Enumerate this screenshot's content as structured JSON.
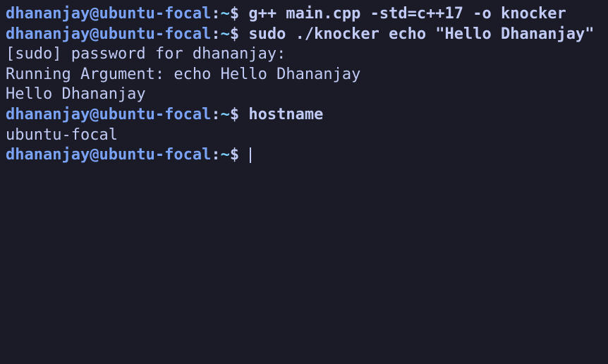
{
  "prompt": {
    "user_host": "dhananjay@ubuntu-focal",
    "colon": ":",
    "path": "~",
    "symbol": "$"
  },
  "lines": [
    {
      "type": "cmd",
      "command": "g++ main.cpp -std=c++17 -o knocker"
    },
    {
      "type": "cmd",
      "command": "sudo ./knocker echo \"Hello Dhananjay\""
    },
    {
      "type": "out",
      "text": "[sudo] password for dhananjay: "
    },
    {
      "type": "out",
      "text": "Running Argument: echo Hello Dhananjay"
    },
    {
      "type": "out",
      "text": "Hello Dhananjay"
    },
    {
      "type": "cmd",
      "command": "hostname"
    },
    {
      "type": "out",
      "text": "ubuntu-focal"
    },
    {
      "type": "cmd",
      "command": "",
      "cursor": true
    }
  ]
}
